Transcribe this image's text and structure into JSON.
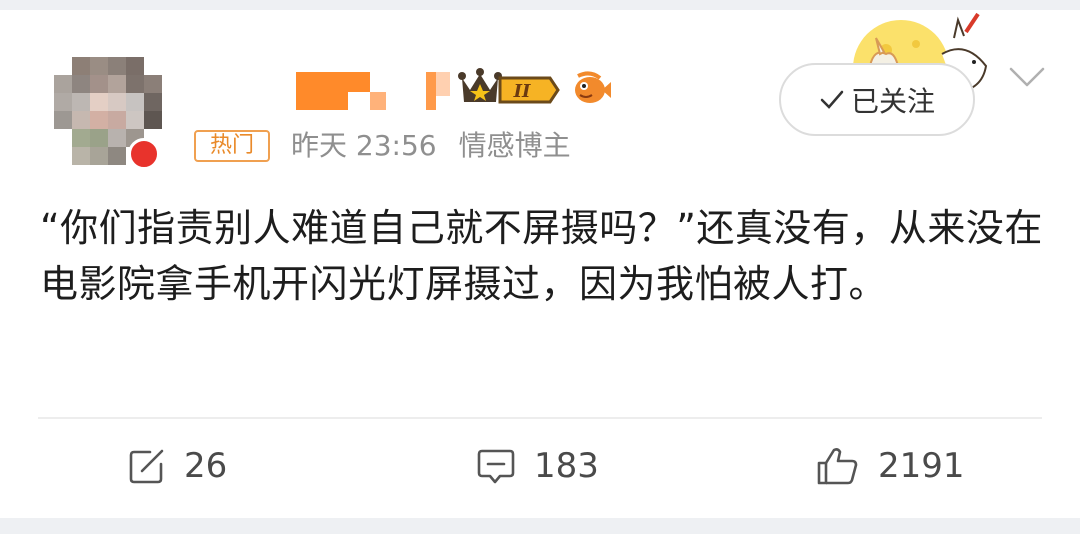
{
  "post": {
    "tag": "热门",
    "time": "昨天 23:56",
    "category": "情感博主",
    "follow_label": "已关注",
    "text": "“你们指责别人难道自己就不屏摄吗？”还真没有，从来没在电影院拿手机开闪光灯屏摄过，因为我怕被人打。",
    "level_badge": "II"
  },
  "actions": {
    "repost_count": "26",
    "comment_count": "183",
    "like_count": "2191"
  },
  "colors": {
    "accent_orange": "#ff8200",
    "tag_border": "#f0a050",
    "meta_gray": "#8f8f8f"
  },
  "icons": [
    "repost-icon",
    "comment-icon",
    "like-icon",
    "check-icon",
    "chevron-down-icon",
    "crown-icon",
    "fish-badge-icon"
  ]
}
